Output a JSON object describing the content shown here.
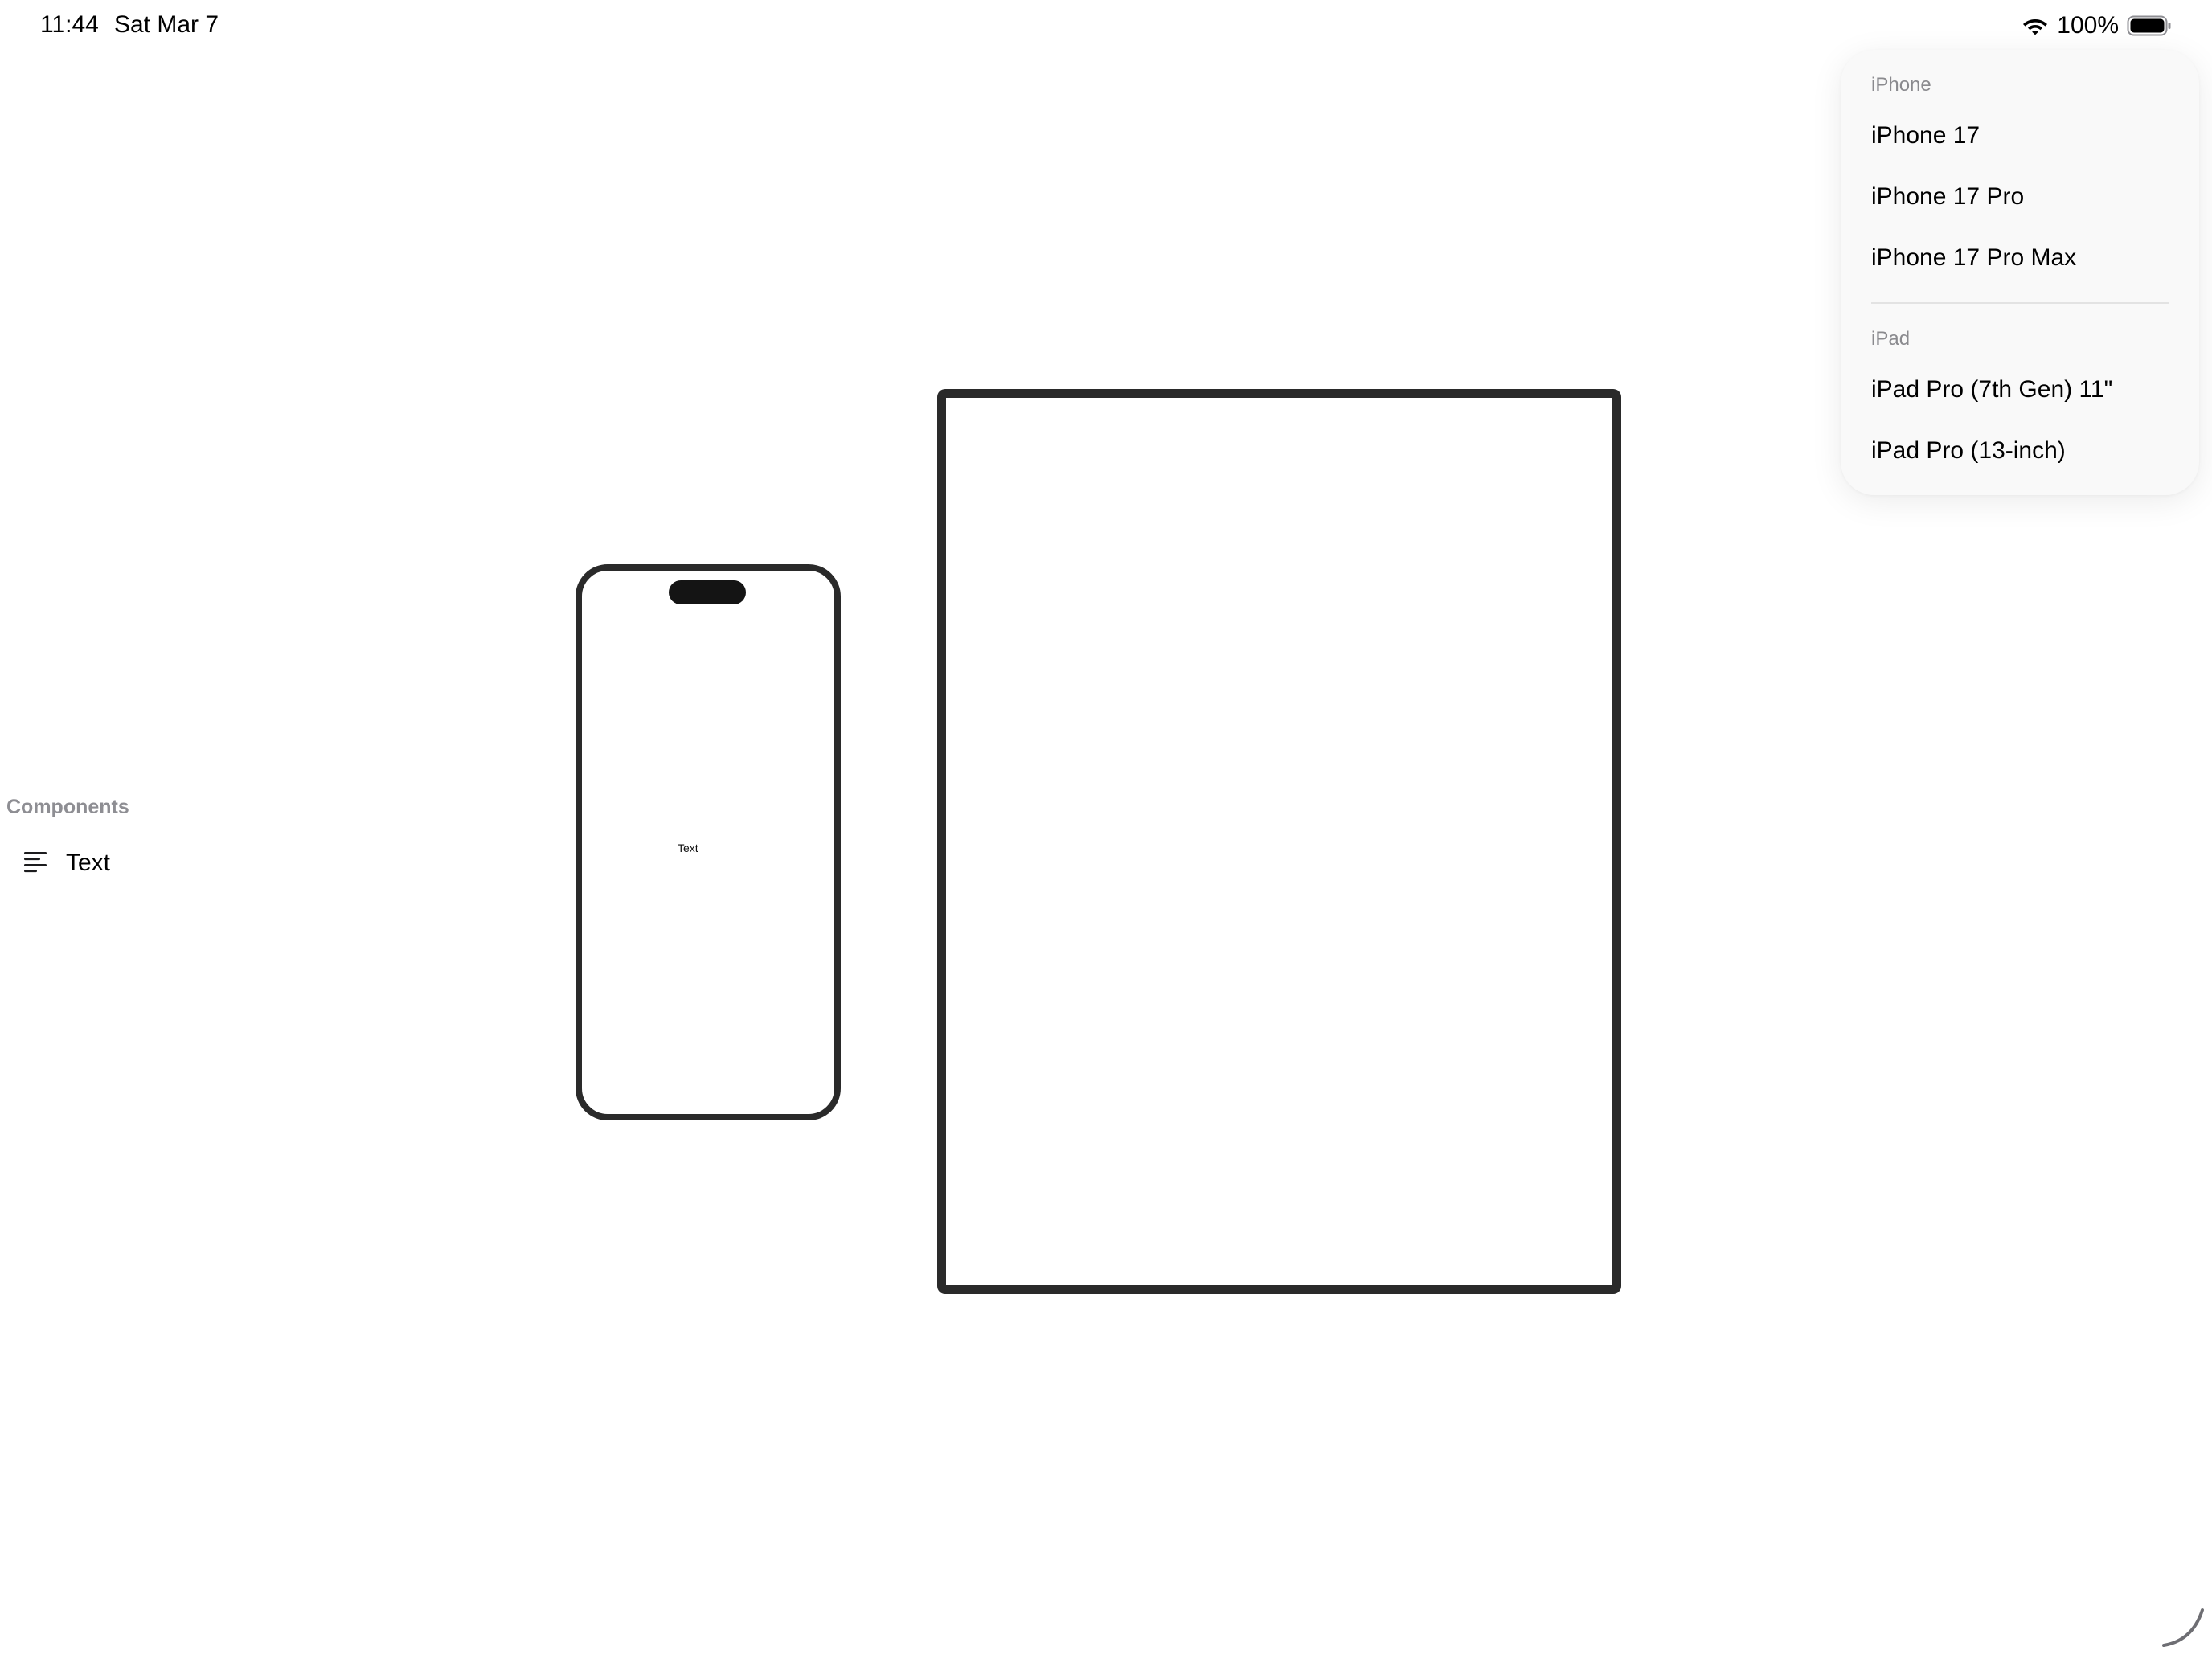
{
  "status_bar": {
    "time": "11:44",
    "date": "Sat Mar 7",
    "battery_percent": "100%",
    "wifi_icon": "wifi-icon",
    "battery_icon": "battery-icon"
  },
  "components_panel": {
    "title": "Components",
    "items": [
      {
        "label": "Text",
        "icon": "text-align-left-icon"
      }
    ]
  },
  "canvas": {
    "iphone_preview_text": "Text"
  },
  "device_menu": {
    "sections": [
      {
        "title": "iPhone",
        "items": [
          "iPhone 17",
          "iPhone 17 Pro",
          "iPhone 17 Pro Max"
        ]
      },
      {
        "title": "iPad",
        "items": [
          "iPad Pro (7th Gen) 11\"",
          "iPad Pro (13-inch)"
        ]
      }
    ]
  },
  "colors": {
    "frame": "#2a2a2a",
    "secondary_text": "#8e8e93",
    "menu_background": "#f9f9f9"
  }
}
